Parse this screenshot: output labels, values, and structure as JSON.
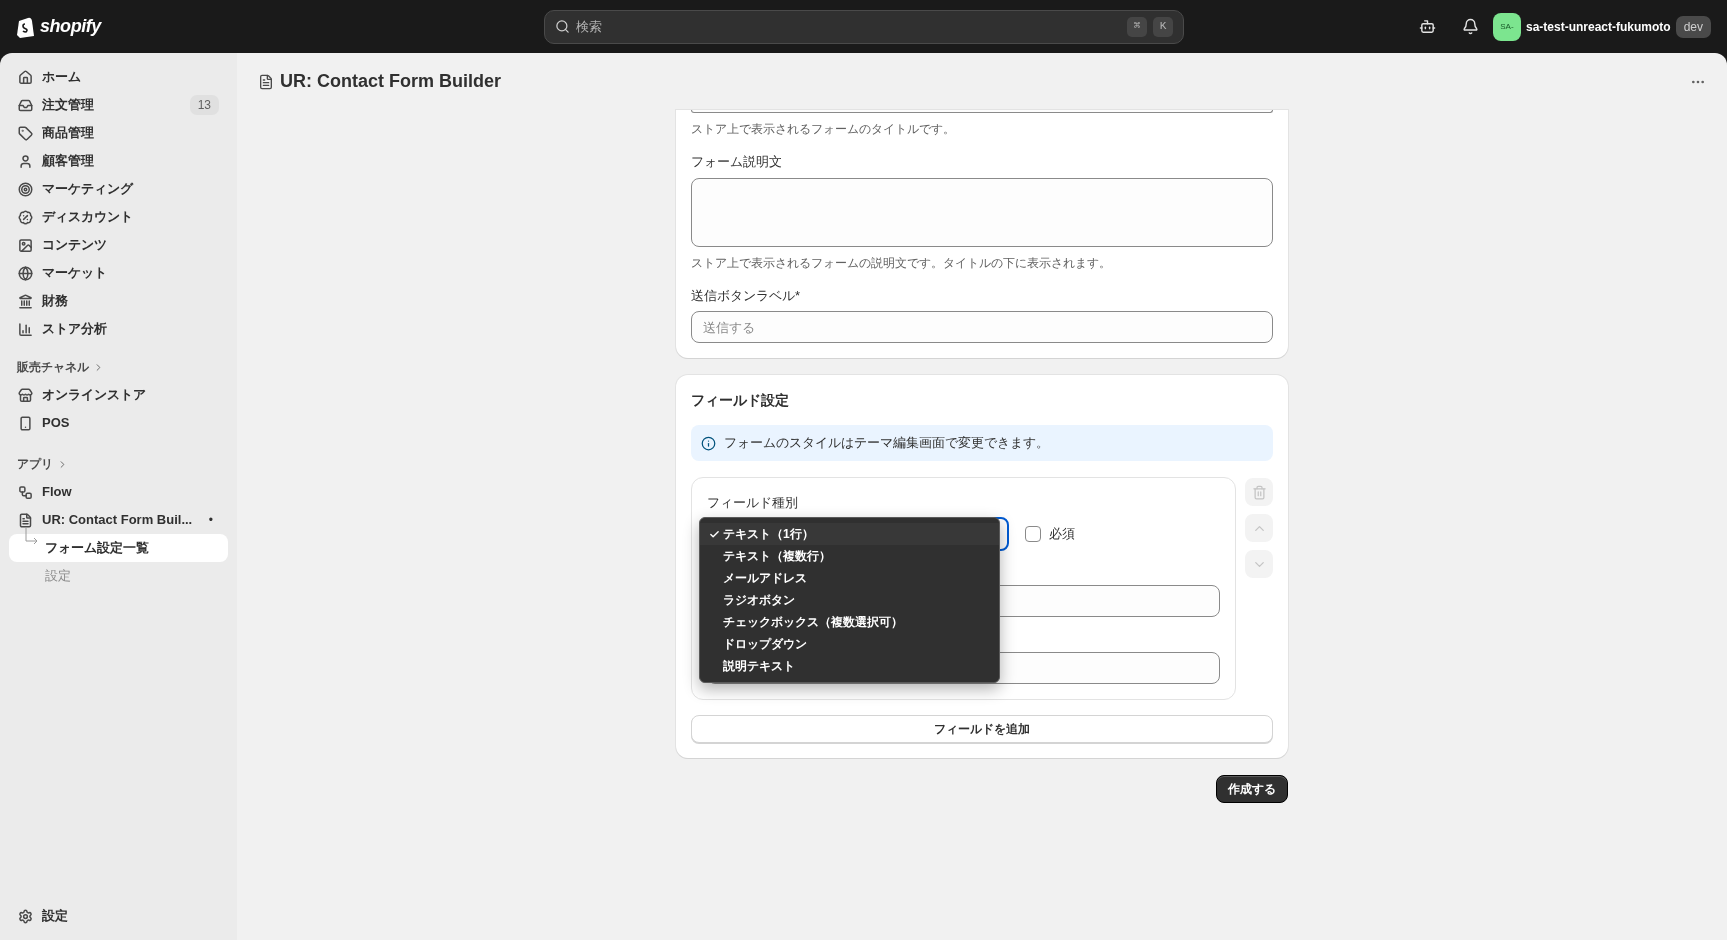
{
  "topbar": {
    "logo": "shopify",
    "search": {
      "placeholder": "検索",
      "shortcut": [
        "⌘",
        "K"
      ]
    },
    "store": {
      "avatar": "SA-",
      "name": "sa-test-unreact-fukumoto",
      "badge": "dev"
    }
  },
  "sidebar": {
    "main": [
      {
        "label": "ホーム"
      },
      {
        "label": "注文管理",
        "badge": "13"
      },
      {
        "label": "商品管理"
      },
      {
        "label": "顧客管理"
      },
      {
        "label": "マーケティング"
      },
      {
        "label": "ディスカウント"
      },
      {
        "label": "コンテンツ"
      },
      {
        "label": "マーケット"
      },
      {
        "label": "財務"
      },
      {
        "label": "ストア分析"
      }
    ],
    "sales_channels": {
      "title": "販売チャネル",
      "items": [
        {
          "label": "オンラインストア"
        },
        {
          "label": "POS"
        }
      ]
    },
    "apps": {
      "title": "アプリ",
      "items": [
        {
          "label": "Flow"
        },
        {
          "label": "UR: Contact Form Buil...",
          "indicator": "•",
          "children": [
            {
              "label": "フォーム設定一覧",
              "selected": true
            },
            {
              "label": "設定",
              "selected": false
            }
          ]
        }
      ]
    },
    "settings": "設定"
  },
  "page": {
    "title": "UR: Contact Form Builder"
  },
  "form_card": {
    "title_help": "ストア上で表示されるフォームのタイトルです。",
    "description": {
      "label": "フォーム説明文",
      "help": "ストア上で表示されるフォームの説明文です。タイトルの下に表示されます。"
    },
    "submit_label": {
      "label": "送信ボタンラベル*",
      "placeholder": "送信する"
    }
  },
  "fields_card": {
    "title": "フィールド設定",
    "banner": "フォームのスタイルはテーマ編集画面で変更できます。",
    "field": {
      "type_label": "フィールド種別",
      "required": {
        "label": "必須",
        "checked": false
      },
      "type_menu": [
        {
          "label": "テキスト（1行）",
          "selected": true
        },
        {
          "label": "テキスト（複数行）",
          "selected": false
        },
        {
          "label": "メールアドレス",
          "selected": false
        },
        {
          "label": "ラジオボタン",
          "selected": false
        },
        {
          "label": "チェックボックス（複数選択可）",
          "selected": false
        },
        {
          "label": "ドロップダウン",
          "selected": false
        },
        {
          "label": "説明テキスト",
          "selected": false
        }
      ],
      "actions": [
        {
          "kind": "delete",
          "disabled": true
        },
        {
          "kind": "up",
          "disabled": true
        },
        {
          "kind": "down",
          "disabled": true
        }
      ]
    },
    "add_button": "フィールドを追加"
  },
  "create_button": "作成する"
}
